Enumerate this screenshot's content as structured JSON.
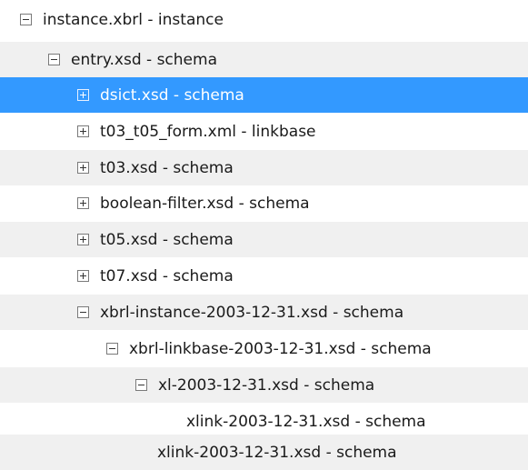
{
  "tree": {
    "rows": [
      {
        "label": "instance.xbrl - instance",
        "toggle": "minus"
      },
      {
        "label": "entry.xsd - schema",
        "toggle": "minus"
      },
      {
        "label": "dsict.xsd - schema",
        "toggle": "plus",
        "selected": true
      },
      {
        "label": "t03_t05_form.xml - linkbase",
        "toggle": "plus"
      },
      {
        "label": "t03.xsd - schema",
        "toggle": "plus"
      },
      {
        "label": "boolean-filter.xsd - schema",
        "toggle": "plus"
      },
      {
        "label": "t05.xsd - schema",
        "toggle": "plus"
      },
      {
        "label": "t07.xsd - schema",
        "toggle": "plus"
      },
      {
        "label": "xbrl-instance-2003-12-31.xsd - schema",
        "toggle": "minus"
      },
      {
        "label": "xbrl-linkbase-2003-12-31.xsd - schema",
        "toggle": "minus"
      },
      {
        "label": "xl-2003-12-31.xsd - schema",
        "toggle": "minus"
      },
      {
        "label": "xlink-2003-12-31.xsd - schema",
        "toggle": "none"
      },
      {
        "label": "xlink-2003-12-31.xsd - schema",
        "toggle": "none"
      }
    ]
  },
  "colors": {
    "selection": "#3399ff",
    "alternate_row": "#f0f0f0"
  }
}
